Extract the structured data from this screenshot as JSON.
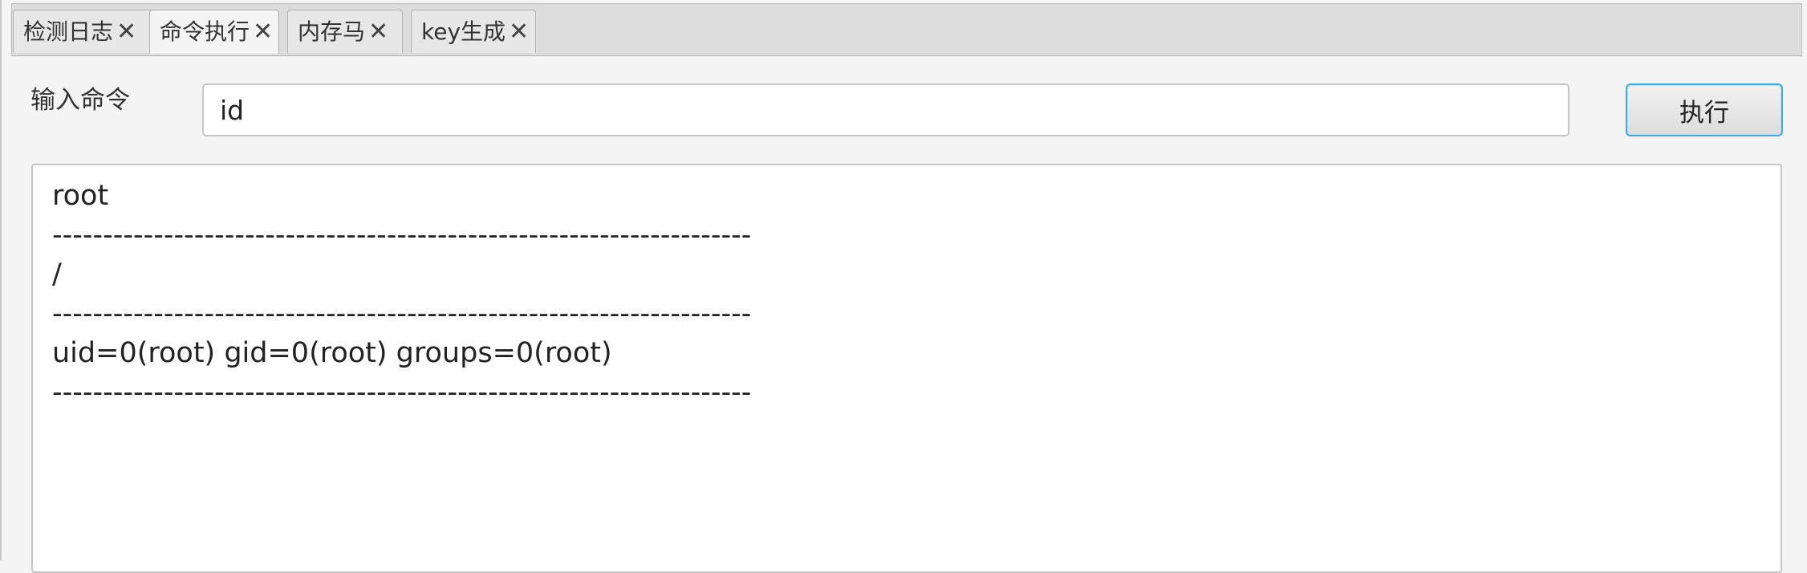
{
  "tabs": [
    {
      "label": "检测日志",
      "close": "✕"
    },
    {
      "label": "命令执行",
      "close": "✕"
    },
    {
      "label": "内存马",
      "close": "✕"
    },
    {
      "label": "key生成",
      "close": "✕"
    }
  ],
  "command": {
    "label": "输入命令",
    "value": "id",
    "button_label": "执行"
  },
  "output": {
    "lines": [
      "root",
      "---------------------------------------------------------------------",
      "/",
      "---------------------------------------------------------------------",
      "uid=0(root) gid=0(root) groups=0(root)",
      "---------------------------------------------------------------------"
    ]
  },
  "colors": {
    "accent": "#3fa8de",
    "background": "#f4f4f4"
  }
}
